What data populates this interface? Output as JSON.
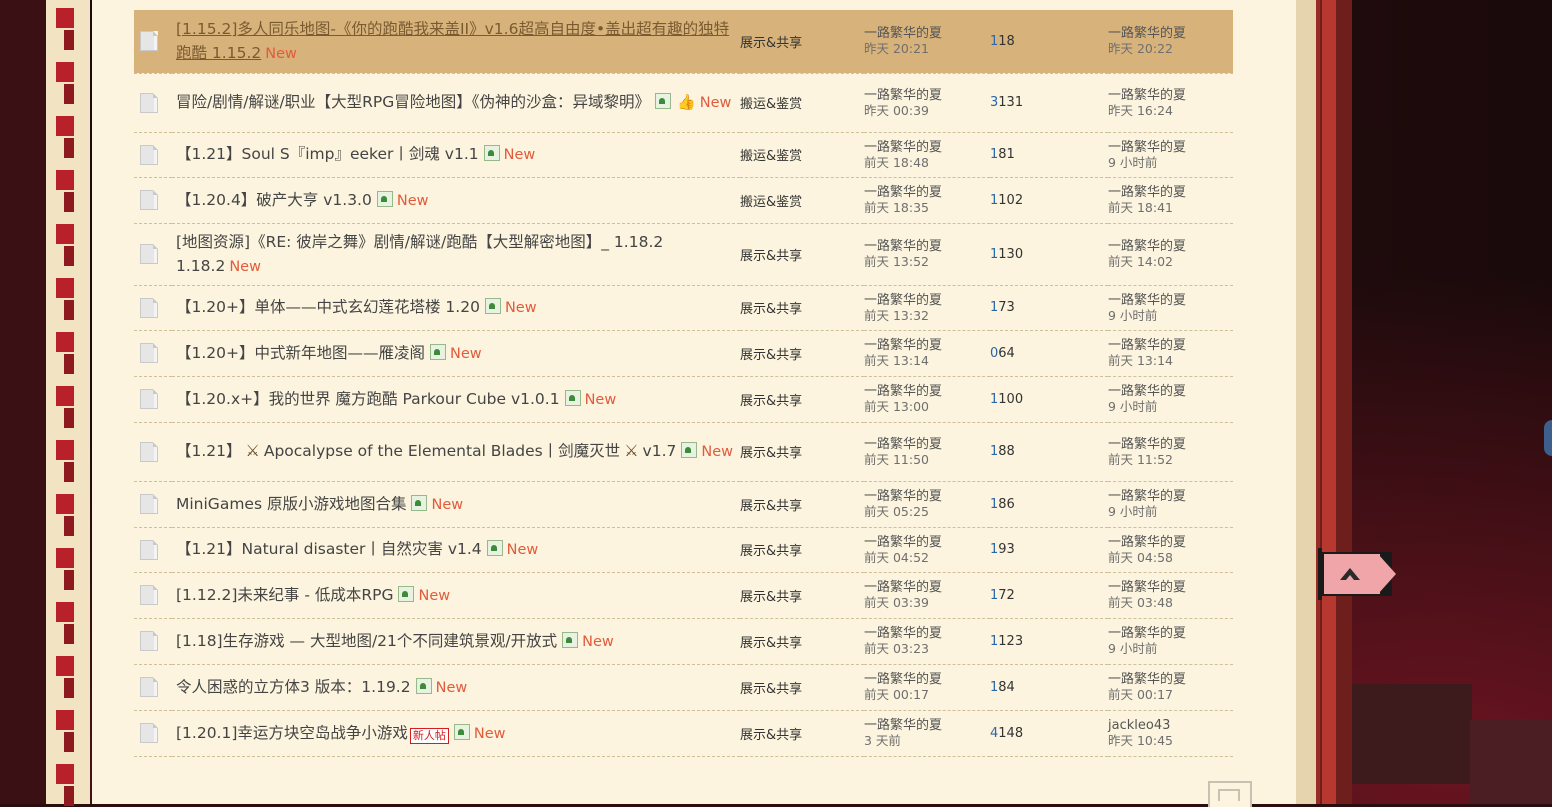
{
  "threads": [
    {
      "title": "[1.15.2]多人同乐地图-《你的跑酷我来盖II》v1.6超高自由度•盖出超有趣的独特跑酷 1.15.2",
      "attach_icon": "",
      "new_label": "New",
      "forum": "展示&共享",
      "author": "一路繁华的夏",
      "post_time": "昨天 20:21",
      "replies": "1",
      "views": "18",
      "last_poster": "一路繁华的夏",
      "last_time": "昨天 20:22",
      "highlight": true
    },
    {
      "title": "冒险/剧情/解谜/职业【大型RPG冒险地图】《伪神的沙盒：异域黎明》",
      "attach_icon": "image-attachment-icon",
      "extra_icon": "thumb-up-icon",
      "new_label": "New",
      "forum": "搬运&鉴赏",
      "author": "一路繁华的夏",
      "post_time": "昨天 00:39",
      "replies": "3",
      "views": "131",
      "last_poster": "一路繁华的夏",
      "last_time": "昨天 16:24"
    },
    {
      "title": "【1.21】Soul S『imp』eeker丨剑魂 v1.1",
      "attach_icon": "image-attachment-icon",
      "new_label": "New",
      "forum": "搬运&鉴赏",
      "author": "一路繁华的夏",
      "post_time": "前天 18:48",
      "replies": "1",
      "views": "81",
      "last_poster": "一路繁华的夏",
      "last_time": "9 小时前"
    },
    {
      "title": "【1.20.4】破产大亨 v1.3.0",
      "attach_icon": "image-attachment-icon",
      "new_label": "New",
      "forum": "搬运&鉴赏",
      "author": "一路繁华的夏",
      "post_time": "前天 18:35",
      "replies": "1",
      "views": "102",
      "last_poster": "一路繁华的夏",
      "last_time": "前天 18:41"
    },
    {
      "title": "[地图资源]《RE: 彼岸之舞》剧情/解谜/跑酷【大型解密地图】_ 1.18.2 1.18.2",
      "attach_icon": "",
      "new_label": "New",
      "forum": "展示&共享",
      "author": "一路繁华的夏",
      "post_time": "前天 13:52",
      "replies": "1",
      "views": "130",
      "last_poster": "一路繁华的夏",
      "last_time": "前天 14:02"
    },
    {
      "title": "【1.20+】单体——中式玄幻莲花塔楼 1.20",
      "attach_icon": "image-attachment-icon",
      "new_label": "New",
      "forum": "展示&共享",
      "author": "一路繁华的夏",
      "post_time": "前天 13:32",
      "replies": "1",
      "views": "73",
      "last_poster": "一路繁华的夏",
      "last_time": "9 小时前"
    },
    {
      "title": "【1.20+】中式新年地图——雁凌阁",
      "attach_icon": "image-attachment-icon",
      "new_label": "New",
      "forum": "展示&共享",
      "author": "一路繁华的夏",
      "post_time": "前天 13:14",
      "replies": "0",
      "views": "64",
      "last_poster": "一路繁华的夏",
      "last_time": "前天 13:14"
    },
    {
      "title": "【1.20.x+】我的世界 魔方跑酷 Parkour Cube v1.0.1",
      "attach_icon": "image-attachment-icon",
      "new_label": "New",
      "forum": "展示&共享",
      "author": "一路繁华的夏",
      "post_time": "前天 13:00",
      "replies": "1",
      "views": "100",
      "last_poster": "一路繁华的夏",
      "last_time": "9 小时前"
    },
    {
      "title_pre": "【1.21】",
      "title_mid": "Apocalypse of the Elemental Blades丨剑魔灭世",
      "title_post": "v1.7",
      "swords": true,
      "attach_icon": "image-attachment-icon",
      "new_label": "New",
      "forum": "展示&共享",
      "author": "一路繁华的夏",
      "post_time": "前天 11:50",
      "replies": "1",
      "views": "88",
      "last_poster": "一路繁华的夏",
      "last_time": "前天 11:52"
    },
    {
      "title": "MiniGames 原版小游戏地图合集",
      "attach_icon": "image-attachment-icon",
      "new_label": "New",
      "forum": "展示&共享",
      "author": "一路繁华的夏",
      "post_time": "前天 05:25",
      "replies": "1",
      "views": "86",
      "last_poster": "一路繁华的夏",
      "last_time": "9 小时前"
    },
    {
      "title": "【1.21】Natural disaster丨自然灾害 v1.4",
      "attach_icon": "image-attachment-icon",
      "new_label": "New",
      "forum": "展示&共享",
      "author": "一路繁华的夏",
      "post_time": "前天 04:52",
      "replies": "1",
      "views": "93",
      "last_poster": "一路繁华的夏",
      "last_time": "前天 04:58"
    },
    {
      "title": "[1.12.2]未来纪事 - 低成本RPG",
      "attach_icon": "image-attachment-icon",
      "new_label": "New",
      "forum": "展示&共享",
      "author": "一路繁华的夏",
      "post_time": "前天 03:39",
      "replies": "1",
      "views": "72",
      "last_poster": "一路繁华的夏",
      "last_time": "前天 03:48"
    },
    {
      "title": "[1.18]生存游戏 — 大型地图/21个不同建筑景观/开放式",
      "attach_icon": "image-attachment-icon",
      "new_label": "New",
      "forum": "展示&共享",
      "author": "一路繁华的夏",
      "post_time": "前天 03:23",
      "replies": "1",
      "views": "123",
      "last_poster": "一路繁华的夏",
      "last_time": "9 小时前"
    },
    {
      "title": "令人困惑的立方体3 版本：1.19.2",
      "attach_icon": "image-attachment-icon",
      "new_label": "New",
      "forum": "展示&共享",
      "author": "一路繁华的夏",
      "post_time": "前天 00:17",
      "replies": "1",
      "views": "84",
      "last_poster": "一路繁华的夏",
      "last_time": "前天 00:17"
    },
    {
      "title": "[1.20.1]幸运方块空岛战争小游戏",
      "newbie_badge": "新人帖",
      "attach_icon": "image-attachment-icon",
      "new_label": "New",
      "forum": "展示&共享",
      "author": "一路繁华的夏",
      "post_time": "3 天前",
      "replies": "4",
      "views": "148",
      "last_poster": "jackleo43",
      "last_time": "昨天 10:45"
    }
  ],
  "colors": {
    "highlight_row": "#d7b37b",
    "new_tag": "#e15b3c",
    "reply_count": "#2a66a8",
    "panel": "#fcf4de"
  }
}
